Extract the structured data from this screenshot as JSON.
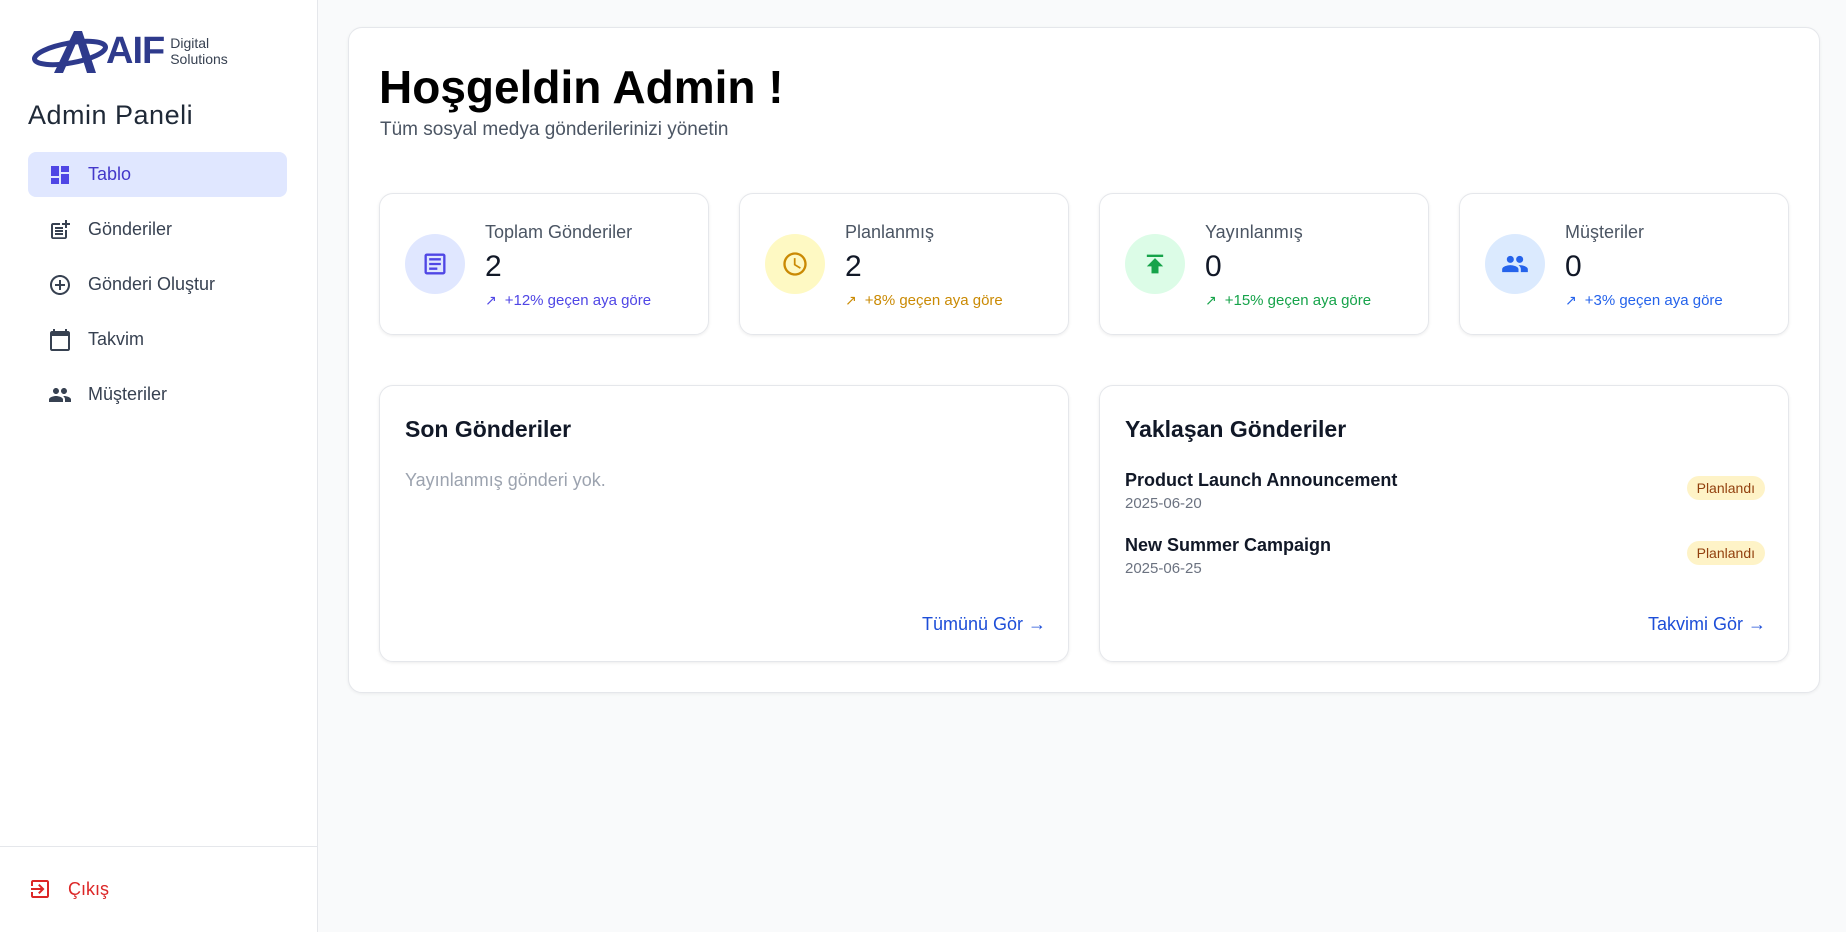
{
  "brand": {
    "name": "AIF",
    "sub_line1": "Digital",
    "sub_line2": "Solutions"
  },
  "sidebar": {
    "title": "Admin Paneli",
    "items": [
      {
        "label": "Tablo",
        "icon": "dashboard-icon",
        "active": true
      },
      {
        "label": "Gönderiler",
        "icon": "post-add-icon",
        "active": false
      },
      {
        "label": "Gönderi Oluştur",
        "icon": "plus-circle-icon",
        "active": false
      },
      {
        "label": "Takvim",
        "icon": "calendar-icon",
        "active": false
      },
      {
        "label": "Müşteriler",
        "icon": "people-icon",
        "active": false
      }
    ],
    "logout": "Çıkış"
  },
  "header": {
    "title": "Hoşgeldin Admin !",
    "subtitle": "Tüm sosyal medya gönderilerinizi yönetin"
  },
  "stats": [
    {
      "label": "Toplam Gönderiler",
      "value": "2",
      "trend": "+12% geçen aya göre",
      "icon": "article-icon",
      "color": "#4f46e5",
      "bg": "#e0e7ff"
    },
    {
      "label": "Planlanmış",
      "value": "2",
      "trend": "+8% geçen aya göre",
      "icon": "clock-icon",
      "color": "#ca8a04",
      "bg": "#fef9c3"
    },
    {
      "label": "Yayınlanmış",
      "value": "0",
      "trend": "+15% geçen aya göre",
      "icon": "publish-icon",
      "color": "#16a34a",
      "bg": "#dcfce7"
    },
    {
      "label": "Müşteriler",
      "value": "0",
      "trend": "+3% geçen aya göre",
      "icon": "people-icon",
      "color": "#2563eb",
      "bg": "#dbeafe"
    }
  ],
  "recent": {
    "title": "Son Gönderiler",
    "empty": "Yayınlanmış gönderi yok.",
    "link": "Tümünü Gör →"
  },
  "upcoming": {
    "title": "Yaklaşan Gönderiler",
    "posts": [
      {
        "title": "Product Launch Announcement",
        "date": "2025-06-20",
        "status": "Planlandı"
      },
      {
        "title": "New Summer Campaign",
        "date": "2025-06-25",
        "status": "Planlandı"
      }
    ],
    "link": "Takvimi Gör →"
  }
}
